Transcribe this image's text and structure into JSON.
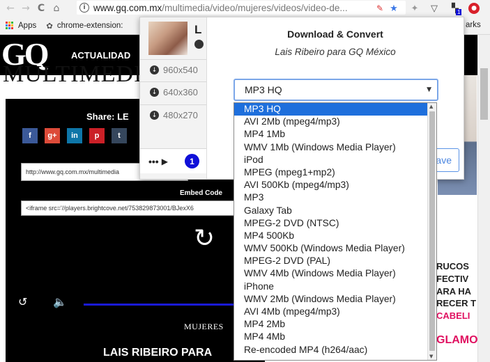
{
  "browser": {
    "back": "←",
    "forward": "→",
    "reload": "C",
    "home": "⌂",
    "url_host": "www.gq.com.mx",
    "url_path": "/multimedia/video/mujeres/videos/video-de...",
    "bookmarks": {
      "apps": "Apps",
      "chrome_ext": "chrome-extension:",
      "right_label": "arks"
    },
    "ext_badge": "1"
  },
  "site": {
    "logo": "GQ",
    "nav_item": "ACTUALIDAD",
    "section_heading": "MULTIMEDIA",
    "share_label": "Share: LE",
    "social": [
      "f",
      "g+",
      "in",
      "p",
      "t"
    ],
    "share_url": "http://www.gq.com.mx/multimedia",
    "embed_label": "Embed Code",
    "embed_code": "<iframe src='//players.brightcove.net/753829873001/BJexX6",
    "category": "MUJERES",
    "video_title": "LAIS RIBEIRO PARA",
    "ad_lines": [
      "RUCOS",
      "FECTIV",
      "ARA HA",
      "RECER T",
      "CABELI"
    ],
    "ad_brand": "GLAMO",
    "colors": {
      "accent_blue": "#1e6fdc",
      "progress_blue": "#1a1ad6",
      "ad_pink": "#e01060"
    }
  },
  "popup": {
    "thumb_letter": "L",
    "resolutions": [
      "960x540",
      "640x360",
      "480x270"
    ],
    "more": "•••",
    "page_badge": "1",
    "title": "Download & Convert",
    "subtitle": "Lais Ribeiro para GQ México",
    "selected_format": "MP3 HQ",
    "save_label": "ave",
    "options": [
      "MP3 HQ",
      "AVI 2Mb (mpeg4/mp3)",
      "MP4 1Mb",
      "WMV 1Mb (Windows Media Player)",
      "iPod",
      "MPEG (mpeg1+mp2)",
      "AVI 500Kb (mpeg4/mp3)",
      "MP3",
      "Galaxy Tab",
      "MPEG-2 DVD (NTSC)",
      "MP4 500Kb",
      "WMV 500Kb (Windows Media Player)",
      "MPEG-2 DVD (PAL)",
      "WMV 4Mb (Windows Media Player)",
      "iPhone",
      "WMV 2Mb (Windows Media Player)",
      "AVI 4Mb (mpeg4/mp3)",
      "MP4 2Mb",
      "MP4 4Mb",
      "Re-encoded MP4 (h264/aac)"
    ]
  }
}
